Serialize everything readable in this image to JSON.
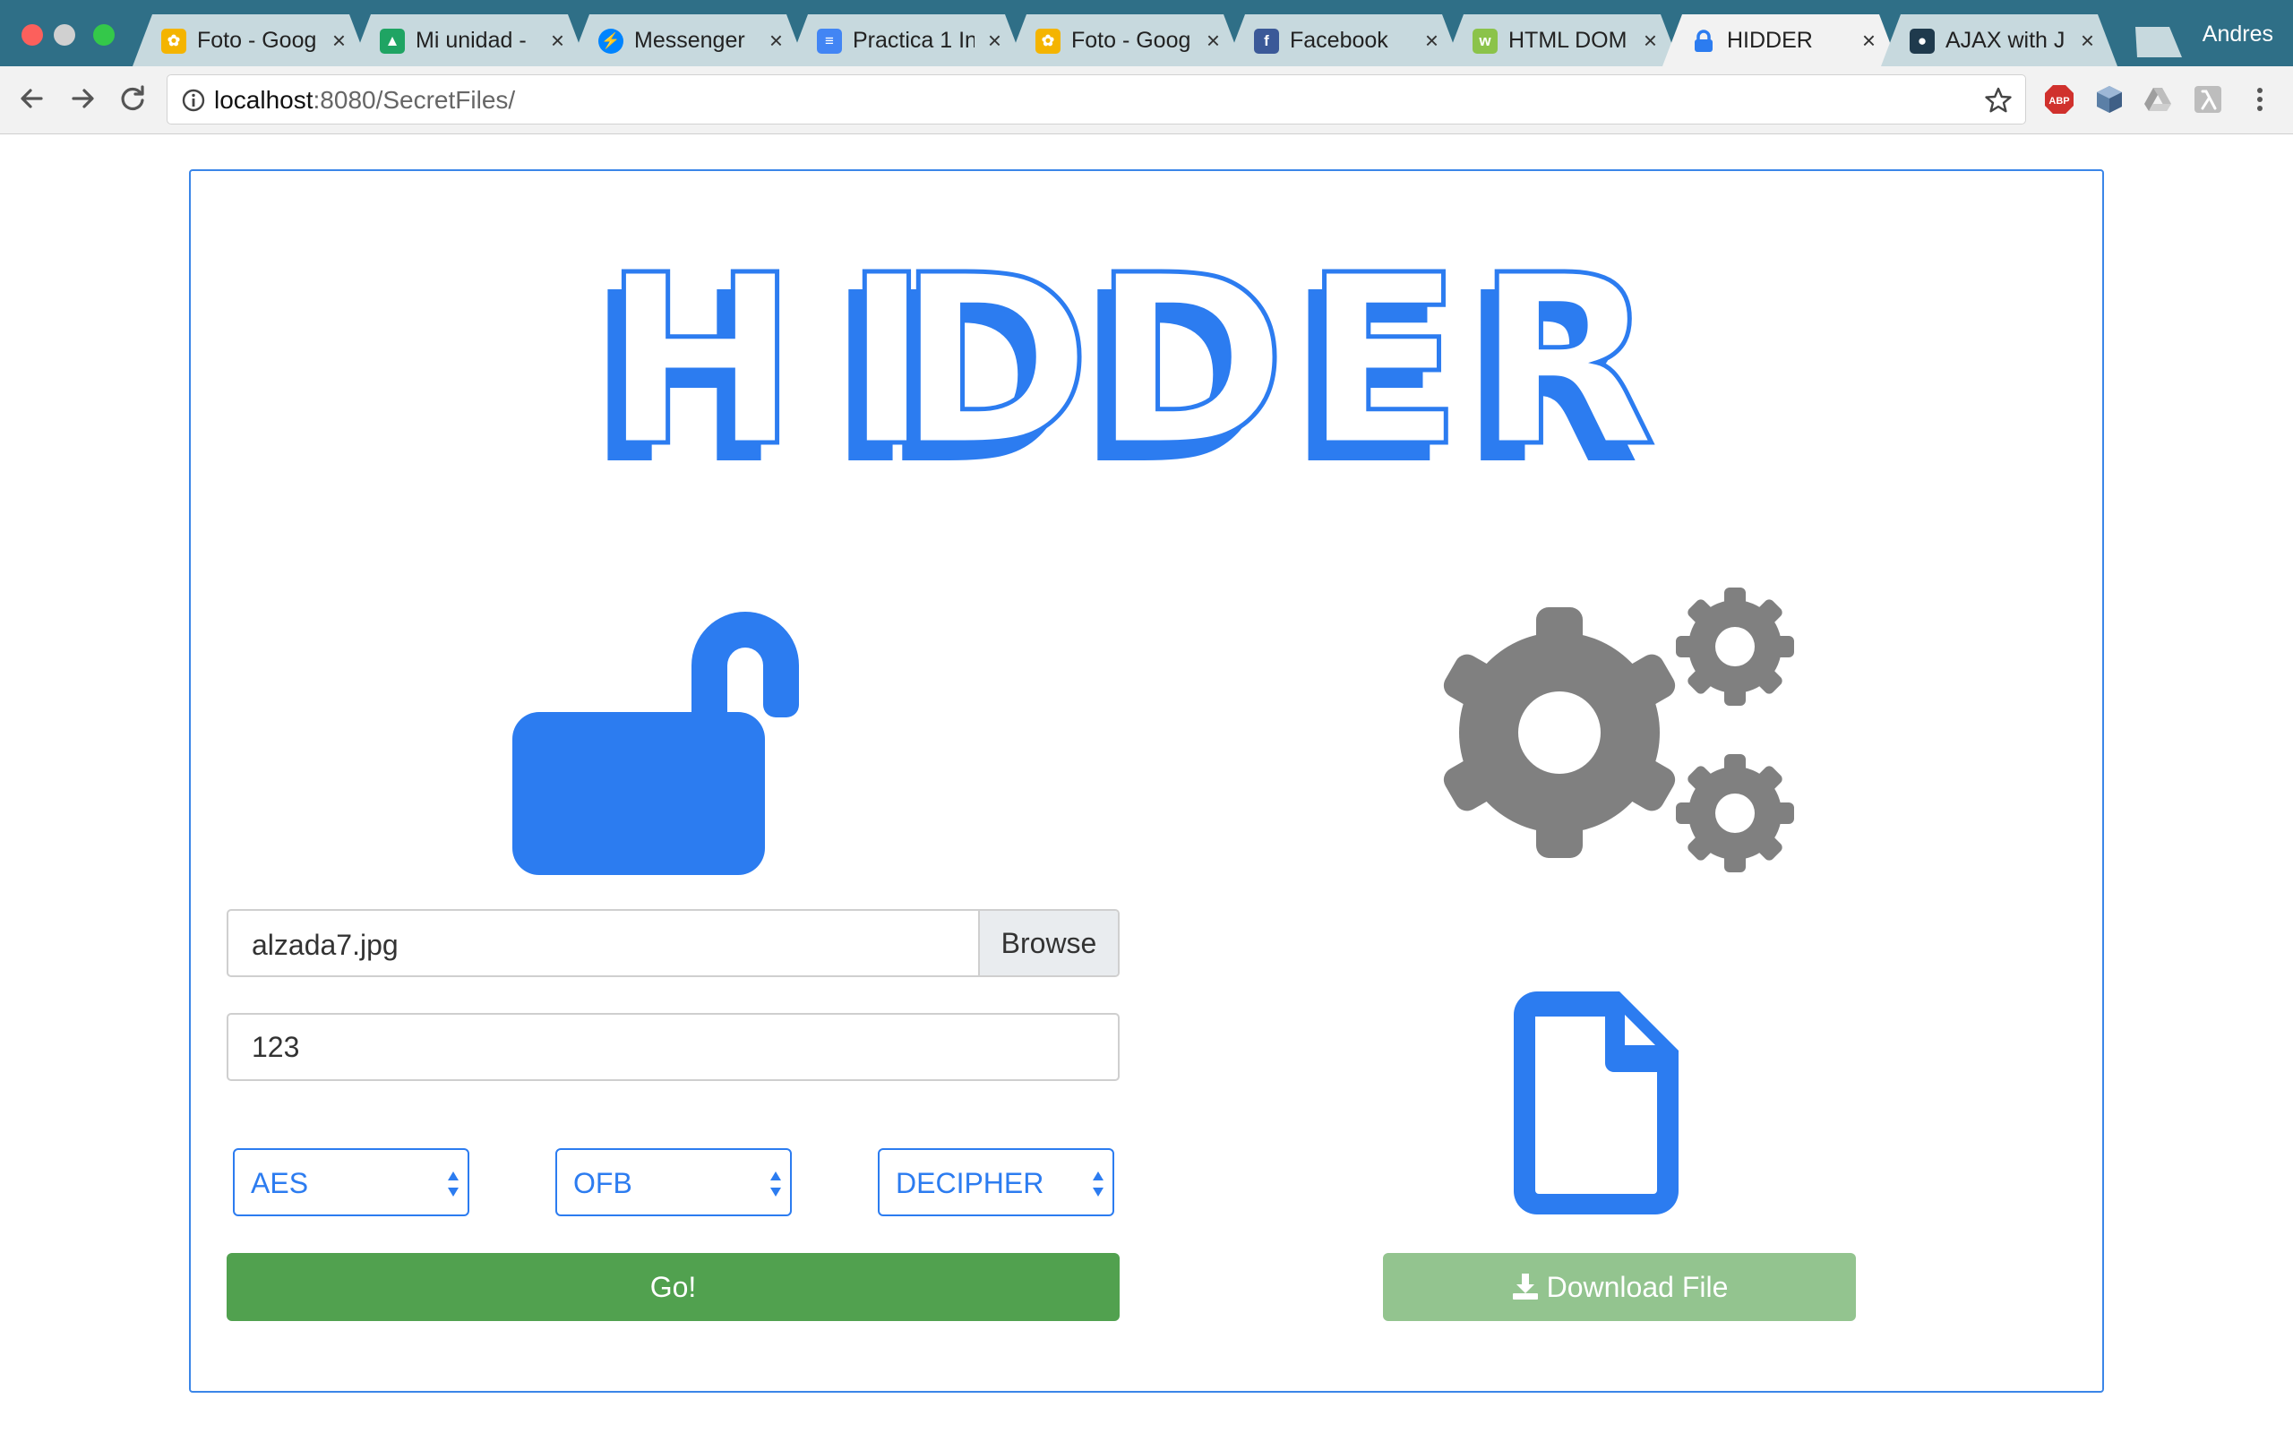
{
  "browser": {
    "tabs": [
      {
        "title": "Foto - Goog",
        "favicon": "google-photos-icon",
        "favicon_color": "#f4b400",
        "active": false
      },
      {
        "title": "Mi unidad -",
        "favicon": "google-drive-icon",
        "favicon_color": "#1fa463",
        "active": false
      },
      {
        "title": "Messenger",
        "favicon": "messenger-icon",
        "favicon_color": "#0084ff",
        "active": false
      },
      {
        "title": "Practica 1 In",
        "favicon": "google-docs-icon",
        "favicon_color": "#4285f4",
        "active": false
      },
      {
        "title": "Foto - Goog",
        "favicon": "google-photos-icon",
        "favicon_color": "#f4b400",
        "active": false
      },
      {
        "title": "Facebook",
        "favicon": "facebook-icon",
        "favicon_color": "#3b5998",
        "active": false
      },
      {
        "title": "HTML DOM",
        "favicon": "w3schools-icon",
        "favicon_color": "#8bc34a",
        "active": false
      },
      {
        "title": "HIDDER",
        "favicon": "lock-icon",
        "favicon_color": "#2c7cf0",
        "active": true
      },
      {
        "title": "AJAX with J",
        "favicon": "chat-icon",
        "favicon_color": "#1f3a4d",
        "active": false
      }
    ],
    "close_glyph": "×",
    "profile_name": "Andres",
    "url_host": "localhost",
    "url_rest": ":8080/SecretFiles/"
  },
  "app": {
    "logo_text": "HIDDER",
    "accent_color": "#2c7cf0",
    "file_name": "alzada7.jpg",
    "browse_label": "Browse",
    "key_value": "123",
    "algorithm_selected": "AES",
    "mode_selected": "OFB",
    "operation_selected": "DECIPHER",
    "go_label": "Go!",
    "download_label": "Download File"
  }
}
